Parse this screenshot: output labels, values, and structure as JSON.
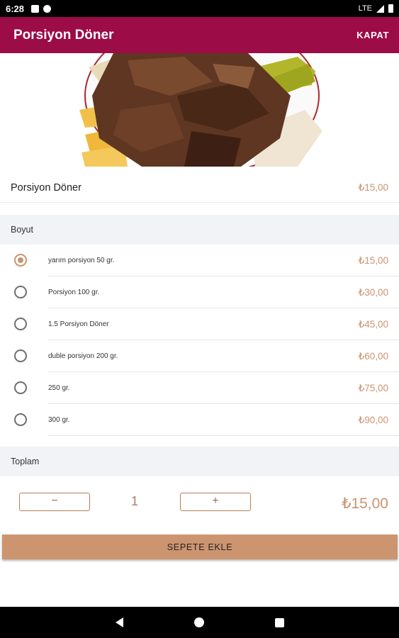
{
  "status_bar": {
    "time": "6:28",
    "network": "LTE"
  },
  "app_bar": {
    "title": "Porsiyon Döner",
    "close_label": "KAPAT"
  },
  "product": {
    "name": "Porsiyon Döner",
    "price": "₺15,00"
  },
  "size_section": {
    "header": "Boyut",
    "options": [
      {
        "label": "yarım porsiyon 50 gr.",
        "price": "₺15,00",
        "selected": true
      },
      {
        "label": "Porsiyon 100 gr.",
        "price": "₺30,00",
        "selected": false
      },
      {
        "label": "1.5 Porsiyon Döner",
        "price": "₺45,00",
        "selected": false
      },
      {
        "label": "duble porsiyon 200 gr.",
        "price": "₺60,00",
        "selected": false
      },
      {
        "label": "250 gr.",
        "price": "₺75,00",
        "selected": false
      },
      {
        "label": "300 gr.",
        "price": "₺90,00",
        "selected": false
      }
    ]
  },
  "total_section": {
    "header": "Toplam",
    "minus_symbol": "−",
    "plus_symbol": "+",
    "quantity": "1",
    "total_price": "₺15,00"
  },
  "add_button": {
    "label": "SEPETE EKLE"
  },
  "colors": {
    "app_bar": "#9c0c47",
    "accent": "#c9946f",
    "button": "#cd9470"
  }
}
